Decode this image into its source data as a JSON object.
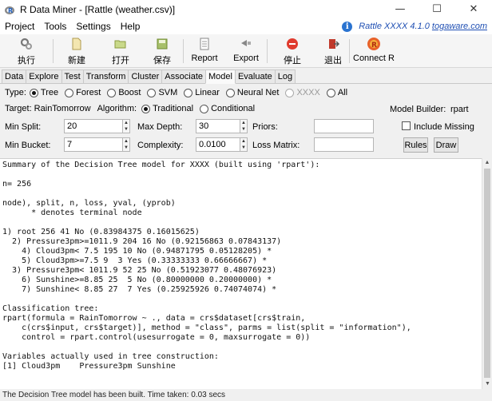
{
  "window": {
    "title": "R Data Miner - [Rattle (weather.csv)]",
    "minimize": "—",
    "maximize": "☐",
    "close": "✕"
  },
  "menu": {
    "items": [
      "Project",
      "Tools",
      "Settings",
      "Help"
    ],
    "brand_text": "Rattle XXXX 4.1.0",
    "brand_link": "togaware.com"
  },
  "toolbar": {
    "buttons": [
      {
        "label": "执行",
        "icon": "gear-icon"
      },
      {
        "label": "新建",
        "icon": "new-file-icon"
      },
      {
        "label": "打开",
        "icon": "folder-icon"
      },
      {
        "label": "保存",
        "icon": "save-icon"
      },
      {
        "label": "Report",
        "icon": "report-icon"
      },
      {
        "label": "Export",
        "icon": "export-icon"
      },
      {
        "label": "停止",
        "icon": "stop-icon"
      },
      {
        "label": "退出",
        "icon": "exit-icon"
      },
      {
        "label": "Connect R",
        "icon": "r-logo-icon"
      }
    ]
  },
  "tabs": [
    "Data",
    "Explore",
    "Test",
    "Transform",
    "Cluster",
    "Associate",
    "Model",
    "Evaluate",
    "Log"
  ],
  "active_tab": "Model",
  "model": {
    "type_label": "Type:",
    "types": [
      {
        "label": "Tree",
        "selected": true,
        "disabled": false
      },
      {
        "label": "Forest",
        "selected": false,
        "disabled": false
      },
      {
        "label": "Boost",
        "selected": false,
        "disabled": false
      },
      {
        "label": "SVM",
        "selected": false,
        "disabled": false
      },
      {
        "label": "Linear",
        "selected": false,
        "disabled": false
      },
      {
        "label": "Neural Net",
        "selected": false,
        "disabled": false
      },
      {
        "label": "XXXX",
        "selected": false,
        "disabled": true
      },
      {
        "label": "All",
        "selected": false,
        "disabled": false
      }
    ],
    "target_label": "Target: RainTomorrow",
    "algorithm_label": "Algorithm:",
    "algorithms": [
      {
        "label": "Traditional",
        "selected": true
      },
      {
        "label": "Conditional",
        "selected": false
      }
    ],
    "builder_label": "Model Builder:",
    "builder_value": "rpart",
    "min_split_label": "Min Split:",
    "min_split": "20",
    "max_depth_label": "Max Depth:",
    "max_depth": "30",
    "priors_label": "Priors:",
    "priors": "",
    "include_missing_label": "Include Missing",
    "min_bucket_label": "Min Bucket:",
    "min_bucket": "7",
    "complexity_label": "Complexity:",
    "complexity": "0.0100",
    "loss_matrix_label": "Loss Matrix:",
    "loss_matrix": "",
    "rules_button": "Rules",
    "draw_button": "Draw"
  },
  "output": {
    "text": "Summary of the Decision Tree model for XXXX (built using 'rpart'):\n\nn= 256\n\nnode), split, n, loss, yval, (yprob)\n      * denotes terminal node\n\n1) root 256 41 No (0.83984375 0.16015625)\n  2) Pressure3pm>=1011.9 204 16 No (0.92156863 0.07843137)\n    4) Cloud3pm< 7.5 195 10 No (0.94871795 0.05128205) *\n    5) Cloud3pm>=7.5 9  3 Yes (0.33333333 0.66666667) *\n  3) Pressure3pm< 1011.9 52 25 No (0.51923077 0.48076923)\n    6) Sunshine>=8.85 25  5 No (0.80000000 0.20000000) *\n    7) Sunshine< 8.85 27  7 Yes (0.25925926 0.74074074) *\n\nClassification tree:\nrpart(formula = RainTomorrow ~ ., data = crs$dataset[crs$train,\n    c(crs$input, crs$target)], method = \"class\", parms = list(split = \"information\"),\n    control = rpart.control(usesurrogate = 0, maxsurrogate = 0))\n\nVariables actually used in tree construction:\n[1] Cloud3pm    Pressure3pm Sunshine"
  },
  "status": "The Decision Tree model has been built. Time taken: 0.03 secs"
}
